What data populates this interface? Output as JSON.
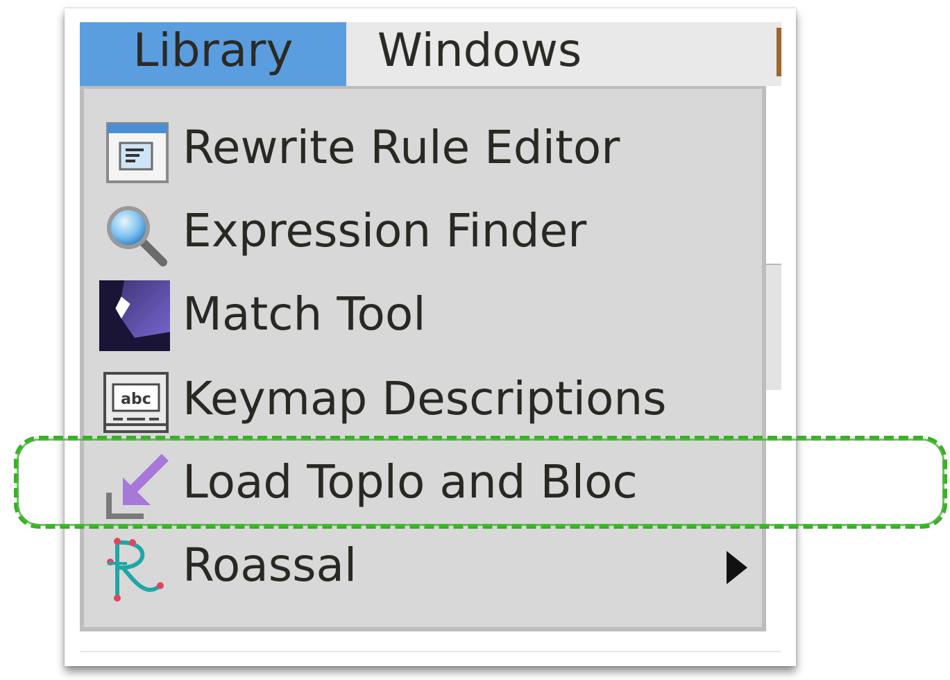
{
  "menubar": {
    "items": [
      {
        "label": "Library",
        "active": true
      },
      {
        "label": "Windows",
        "active": false
      }
    ]
  },
  "dropdown": {
    "items": [
      {
        "label": "Rewrite Rule Editor",
        "icon": "window-editor-icon"
      },
      {
        "label": "Expression Finder",
        "icon": "magnifier-icon"
      },
      {
        "label": "Match Tool",
        "icon": "match-tool-icon"
      },
      {
        "label": "Keymap Descriptions",
        "icon": "keyboard-abc-icon"
      },
      {
        "label": "Load Toplo and Bloc",
        "icon": "load-arrow-icon",
        "highlighted": true
      },
      {
        "label": "Roassal",
        "icon": "roassal-icon",
        "has_submenu": true
      }
    ]
  },
  "colors": {
    "menubar_active": "#5b9ee0",
    "menubar_bg": "#e9e9e9",
    "dropdown_bg": "#d8d8d8",
    "highlight": "#3cae2a"
  }
}
